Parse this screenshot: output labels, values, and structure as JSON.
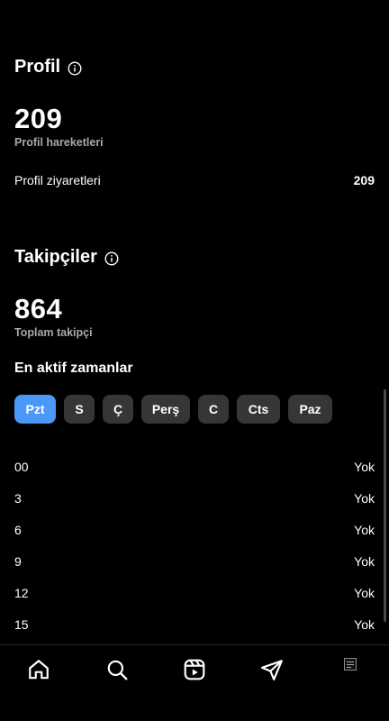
{
  "profile": {
    "title": "Profil",
    "count": "209",
    "count_label": "Profil hareketleri",
    "visits_label": "Profil ziyaretleri",
    "visits_value": "209"
  },
  "followers": {
    "title": "Takipçiler",
    "count": "864",
    "count_label": "Toplam takipçi",
    "active_times_heading": "En aktif zamanlar",
    "days": [
      "Pzt",
      "S",
      "Ç",
      "Perş",
      "C",
      "Cts",
      "Paz"
    ],
    "selected_day": "Pzt",
    "hours": [
      {
        "hour": "00",
        "value": "Yok"
      },
      {
        "hour": "3",
        "value": "Yok"
      },
      {
        "hour": "6",
        "value": "Yok"
      },
      {
        "hour": "9",
        "value": "Yok"
      },
      {
        "hour": "12",
        "value": "Yok"
      },
      {
        "hour": "15",
        "value": "Yok"
      }
    ]
  },
  "tabbar": {
    "icons": [
      "home-icon",
      "search-icon",
      "reels-icon",
      "send-icon",
      "profile-avatar"
    ]
  },
  "colors": {
    "background": "#000000",
    "chip": "#363636",
    "chip_active": "#4a98f7",
    "muted_text": "#a8a8a8"
  }
}
